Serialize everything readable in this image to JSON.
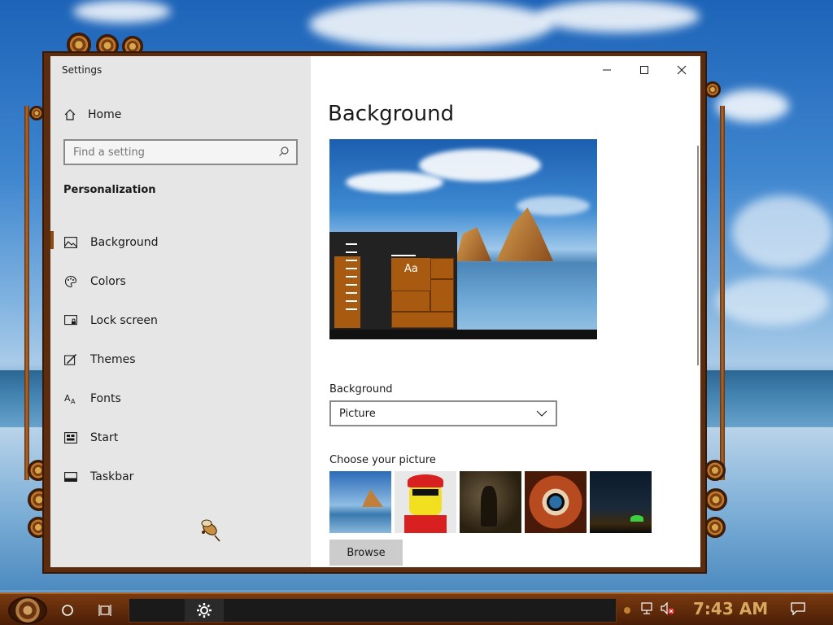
{
  "window": {
    "app_title": "Settings"
  },
  "sidebar": {
    "home_label": "Home",
    "search_placeholder": "Find a setting",
    "section_title": "Personalization",
    "items": [
      {
        "label": "Background",
        "icon": "picture-icon",
        "active": true
      },
      {
        "label": "Colors",
        "icon": "palette-icon",
        "active": false
      },
      {
        "label": "Lock screen",
        "icon": "lock-screen-icon",
        "active": false
      },
      {
        "label": "Themes",
        "icon": "themes-icon",
        "active": false
      },
      {
        "label": "Fonts",
        "icon": "fonts-icon",
        "active": false
      },
      {
        "label": "Start",
        "icon": "start-icon",
        "active": false
      },
      {
        "label": "Taskbar",
        "icon": "taskbar-icon",
        "active": false
      }
    ]
  },
  "content": {
    "page_title": "Background",
    "preview_sample_text": "Aa",
    "background_label": "Background",
    "background_selected": "Picture",
    "choose_label": "Choose your picture",
    "browse_label": "Browse"
  },
  "taskbar": {
    "clock": "7:43 AM"
  },
  "colors": {
    "accent": "#a85a10",
    "sidebar_bg": "#e6e6e6",
    "frame": "#5c2c0e"
  }
}
